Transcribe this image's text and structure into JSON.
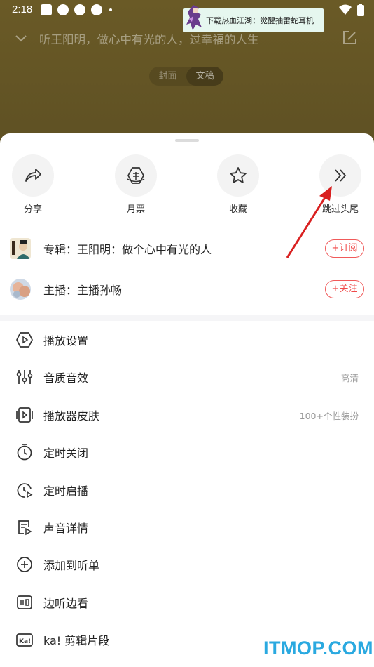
{
  "status_bar": {
    "time": "2:18"
  },
  "ad": {
    "text": "下载热血江湖：觉醒抽雷蛇耳机"
  },
  "header": {
    "title": "听王阳明，做心中有光的人，过幸福的人生"
  },
  "segment": {
    "tabs": [
      {
        "label": "封面"
      },
      {
        "label": "文稿"
      }
    ],
    "selected": "文稿"
  },
  "actions": [
    {
      "label": "分享",
      "icon": "share-icon"
    },
    {
      "label": "月票",
      "icon": "ticket-icon"
    },
    {
      "label": "收藏",
      "icon": "star-icon"
    },
    {
      "label": "跳过头尾",
      "icon": "skip-icon"
    }
  ],
  "album": {
    "text": "专辑：王阳明：做个心中有光的人",
    "button": "+订阅"
  },
  "host": {
    "text": "主播：主播孙畅",
    "button": "+关注"
  },
  "menu": [
    {
      "label": "播放设置",
      "value": "",
      "icon": "play-settings-icon"
    },
    {
      "label": "音质音效",
      "value": "高清",
      "icon": "equalizer-icon"
    },
    {
      "label": "播放器皮肤",
      "value": "100+个性装扮",
      "icon": "skin-icon"
    },
    {
      "label": "定时关闭",
      "value": "",
      "icon": "timer-icon"
    },
    {
      "label": "定时启播",
      "value": "",
      "icon": "timed-start-icon"
    },
    {
      "label": "声音详情",
      "value": "",
      "icon": "details-icon"
    },
    {
      "label": "添加到听单",
      "value": "",
      "icon": "add-icon"
    },
    {
      "label": "边听边看",
      "value": "",
      "icon": "listen-read-icon"
    },
    {
      "label": "ka! 剪辑片段",
      "value": "",
      "icon": "clip-icon"
    }
  ],
  "watermark": "ITMOP.COM",
  "colors": {
    "accent_red": "#f04a4a",
    "watermark_blue": "#2aa9e0",
    "overlay": "#5f5124"
  }
}
